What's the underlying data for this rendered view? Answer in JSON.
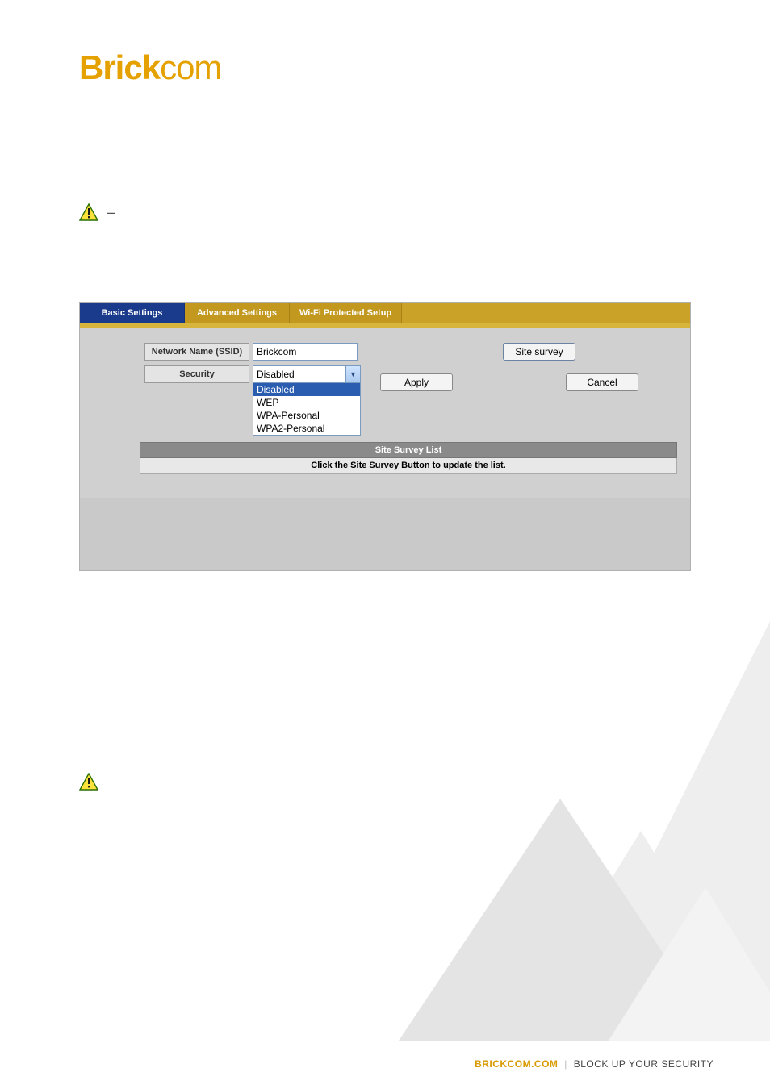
{
  "logo": {
    "bold": "Brick",
    "thin": "com"
  },
  "note_dash": "–",
  "ui": {
    "tabs": {
      "basic": "Basic Settings",
      "advanced": "Advanced Settings",
      "wps": "Wi-Fi Protected Setup"
    },
    "labels": {
      "ssid": "Network Name (SSID)",
      "security": "Security"
    },
    "ssid_value": "Brickcom",
    "site_survey_btn": "Site survey",
    "security_selected": "Disabled",
    "security_options": [
      "Disabled",
      "WEP",
      "WPA-Personal",
      "WPA2-Personal"
    ],
    "apply_btn": "Apply",
    "cancel_btn": "Cancel",
    "survey_bar": "Site Survey List",
    "survey_hint": "Click the Site Survey Button to update the list."
  },
  "footer": {
    "brand": "BRICKCOM.COM",
    "sep": "|",
    "tag": "BLOCK UP YOUR SECURITY"
  }
}
